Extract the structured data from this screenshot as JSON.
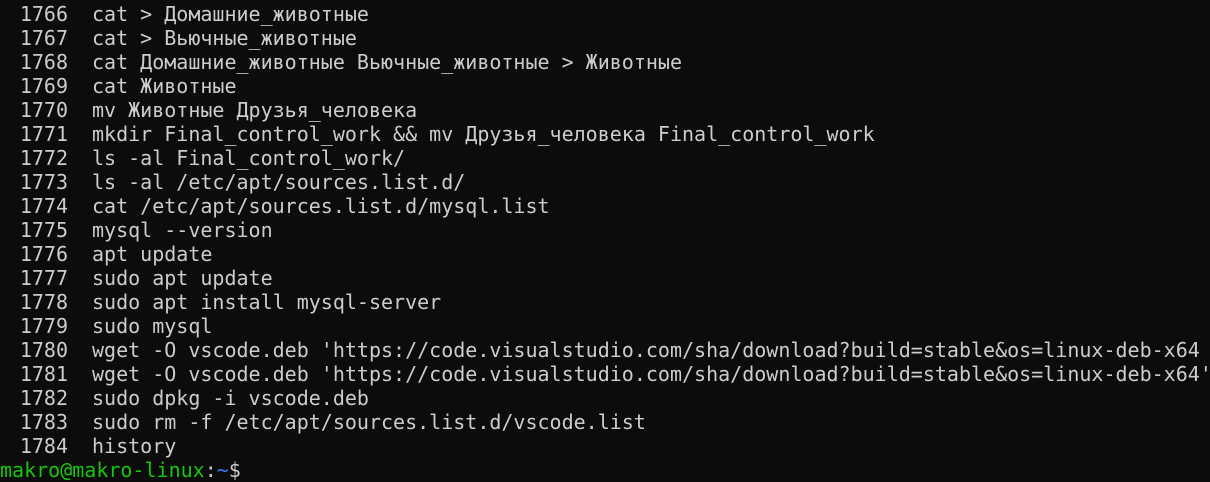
{
  "terminal": {
    "history": [
      {
        "num": "1766",
        "cmd": "cat > Домашние_животные"
      },
      {
        "num": "1767",
        "cmd": "cat > Вьючные_животные"
      },
      {
        "num": "1768",
        "cmd": "cat Домашние_животные Вьючные_животные > Животные"
      },
      {
        "num": "1769",
        "cmd": "cat Животные"
      },
      {
        "num": "1770",
        "cmd": "mv Животные Друзья_человека"
      },
      {
        "num": "1771",
        "cmd": "mkdir Final_control_work && mv Друзья_человека Final_control_work"
      },
      {
        "num": "1772",
        "cmd": "ls -al Final_control_work/"
      },
      {
        "num": "1773",
        "cmd": "ls -al /etc/apt/sources.list.d/"
      },
      {
        "num": "1774",
        "cmd": "cat /etc/apt/sources.list.d/mysql.list"
      },
      {
        "num": "1775",
        "cmd": "mysql --version"
      },
      {
        "num": "1776",
        "cmd": "apt update"
      },
      {
        "num": "1777",
        "cmd": "sudo apt update"
      },
      {
        "num": "1778",
        "cmd": "sudo apt install mysql-server"
      },
      {
        "num": "1779",
        "cmd": "sudo mysql"
      },
      {
        "num": "1780",
        "cmd": "wget -O vscode.deb 'https://code.visualstudio.com/sha/download?build=stable&os=linux-deb-x64"
      },
      {
        "num": "1781",
        "cmd": "wget -O vscode.deb 'https://code.visualstudio.com/sha/download?build=stable&os=linux-deb-x64'"
      },
      {
        "num": "1782",
        "cmd": "sudo dpkg -i vscode.deb"
      },
      {
        "num": "1783",
        "cmd": "sudo rm -f /etc/apt/sources.list.d/vscode.list"
      },
      {
        "num": "1784",
        "cmd": "history"
      }
    ],
    "prompt": {
      "user_host": "makro@makro-linux",
      "separator": ":",
      "path": "~",
      "symbol": "$"
    },
    "colors": {
      "background": "#0c0c0c",
      "text": "#cccccc",
      "user_host": "#16c60c",
      "path": "#3b78ff"
    }
  }
}
